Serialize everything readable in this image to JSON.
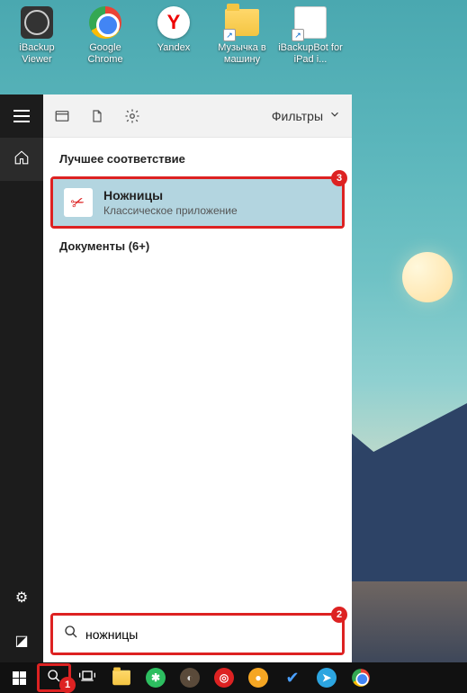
{
  "desktop_icons": [
    {
      "name": "ibackup-viewer",
      "label": "iBackup Viewer"
    },
    {
      "name": "google-chrome",
      "label": "Google Chrome"
    },
    {
      "name": "yandex",
      "label": "Yandex"
    },
    {
      "name": "music-folder",
      "label": "Музычка в машину"
    },
    {
      "name": "ibackupbot",
      "label": "iBackupBot for iPad i..."
    }
  ],
  "search": {
    "filters_label": "Фильтры",
    "best_match_header": "Лучшее соответствие",
    "result_title": "Ножницы",
    "result_subtitle": "Классическое приложение",
    "documents_header": "Документы (6+)",
    "query": "ножницы"
  },
  "annotations": {
    "b1": "1",
    "b2": "2",
    "b3": "3"
  }
}
